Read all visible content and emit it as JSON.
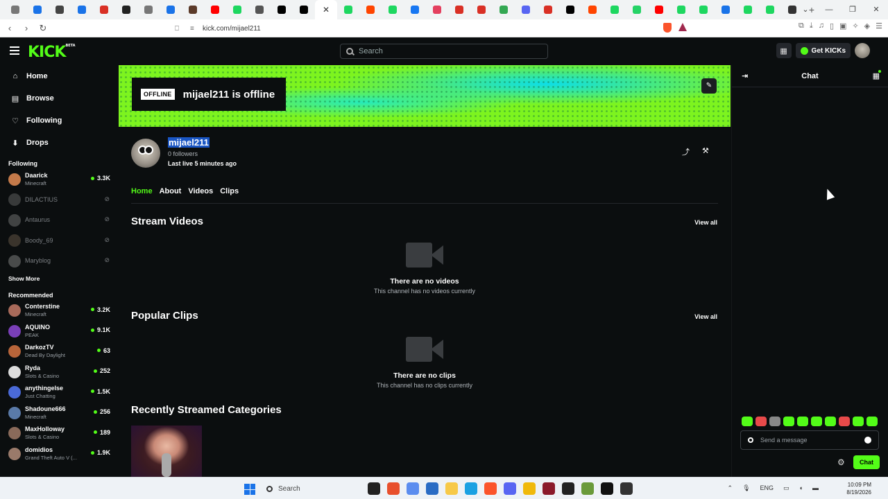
{
  "browser": {
    "url": "kick.com/mijael211",
    "tab_favicon_colors": [
      "#777",
      "#1a73e8",
      "#444",
      "#1a73e8",
      "#d93025",
      "#222",
      "#777",
      "#1a73e8",
      "#5b3a29",
      "#ff0000",
      "#1ed760",
      "#555",
      "#000",
      "#000",
      "#fff",
      "#1ed760",
      "#ff4500",
      "#1ed760",
      "#1877f2",
      "#e4405f",
      "#d93025",
      "#d93025",
      "#34a853",
      "#5865f2",
      "#d93025",
      "#000",
      "#ff4500",
      "#1ed760",
      "#25d366",
      "#ff0000",
      "#1ed760",
      "#1ed760",
      "#1a73e8",
      "#1ed760",
      "#1ed760",
      "#333"
    ]
  },
  "header": {
    "logo_text": "KICK",
    "logo_badge": "BETA",
    "search_placeholder": "Search",
    "get_kicks_label": "Get KICKs"
  },
  "sidebar": {
    "nav": [
      {
        "label": "Home",
        "icon": "home-icon"
      },
      {
        "label": "Browse",
        "icon": "browse-icon"
      },
      {
        "label": "Following",
        "icon": "heart-icon"
      },
      {
        "label": "Drops",
        "icon": "drops-icon"
      }
    ],
    "following_title": "Following",
    "following": [
      {
        "name": "Daarick",
        "category": "Minecraft",
        "viewers": "3.3K",
        "live": true,
        "avatar_color": "#c47a4a"
      },
      {
        "name": "DILACTIUS",
        "category": "",
        "viewers": "",
        "live": false,
        "avatar_color": "#666"
      },
      {
        "name": "Antaurus",
        "category": "",
        "viewers": "",
        "live": false,
        "avatar_color": "#777"
      },
      {
        "name": "Boody_69",
        "category": "",
        "viewers": "",
        "live": false,
        "avatar_color": "#6a5a4a"
      },
      {
        "name": "Maryblog",
        "category": "",
        "viewers": "",
        "live": false,
        "avatar_color": "#888"
      }
    ],
    "show_more": "Show More",
    "recommended_title": "Recommended",
    "recommended": [
      {
        "name": "Conterstine",
        "category": "Minecraft",
        "viewers": "3.2K",
        "avatar_color": "#a86a5a"
      },
      {
        "name": "AQUINO",
        "category": "PEAK",
        "viewers": "9.1K",
        "avatar_color": "#7a3fb8"
      },
      {
        "name": "DarkozTV",
        "category": "Dead By Daylight",
        "viewers": "63",
        "avatar_color": "#b8653a"
      },
      {
        "name": "Ryda",
        "category": "Slots & Casino",
        "viewers": "252",
        "avatar_color": "#ddd"
      },
      {
        "name": "anythingelse",
        "category": "Just Chatting",
        "viewers": "1.5K",
        "avatar_color": "#4a6ad8"
      },
      {
        "name": "Shadoune666",
        "category": "Minecraft",
        "viewers": "256",
        "avatar_color": "#5a7aa8"
      },
      {
        "name": "MaxHolloway",
        "category": "Slots & Casino",
        "viewers": "189",
        "avatar_color": "#8a6a5a"
      },
      {
        "name": "domidios",
        "category": "Grand Theft Auto V (...",
        "viewers": "1.9K",
        "avatar_color": "#9a7a6a"
      }
    ]
  },
  "banner": {
    "offline_badge": "OFFLINE",
    "offline_text": "mijael211 is offline"
  },
  "profile": {
    "username": "mijael211",
    "followers": "0 followers",
    "last_live": "Last live 5 minutes ago"
  },
  "tabs": [
    "Home",
    "About",
    "Videos",
    "Clips"
  ],
  "sections": {
    "stream_videos": {
      "title": "Stream Videos",
      "view_all": "View all",
      "empty_title": "There are no videos",
      "empty_sub": "This channel has no videos currently"
    },
    "popular_clips": {
      "title": "Popular Clips",
      "view_all": "View all",
      "empty_title": "There are no clips",
      "empty_sub": "This channel has no clips currently"
    },
    "recent_categories": {
      "title": "Recently Streamed Categories"
    }
  },
  "chat": {
    "title": "Chat",
    "placeholder": "Send a message",
    "send_label": "Chat"
  },
  "taskbar": {
    "search_label": "Search",
    "lang": "ENG",
    "time": "10:09 PM",
    "date": "8/19/2026"
  }
}
